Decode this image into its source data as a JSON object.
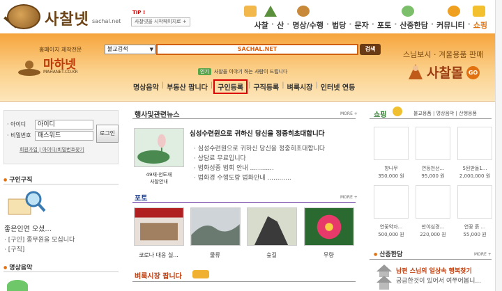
{
  "header": {
    "logo_text": "사찰넷",
    "logo_domain": "sachal.net",
    "tip_label": "TIP !",
    "tip_box": "사찰넷을 시작페이지로 +",
    "nav": [
      "사찰",
      "산",
      "명상/수행",
      "법당",
      "문자",
      "포토",
      "산중한담",
      "커뮤니티",
      "쇼핑"
    ]
  },
  "banner": {
    "mahanet_small": "홈페이지 제작전문",
    "mahanet_name": "마하넷",
    "mahanet_sub": "MAHANET.CO.KR",
    "search_select": "불교검색",
    "search_value": "SACHAL.NET",
    "search_button": "검색",
    "popular_tag": "인기",
    "popular_text": "사찰을 이야기 하는 사람이 드립니다",
    "links": [
      "명상음악",
      "부동산 팝니다",
      "구인등록",
      "구직등록",
      "벼룩시장",
      "인터넷 연등"
    ],
    "mall_top": "스님보시 · 겨울용품 판매",
    "mall_name": "사찰몰",
    "mall_go": "GO"
  },
  "login": {
    "id_label": "· 아이디",
    "pw_label": "· 비밀번호",
    "id_value": "아이디",
    "pw_value": "패스워드",
    "button": "로그인",
    "join": "회원가입",
    "find": "아이디/비밀번호찾기"
  },
  "left": {
    "job_title": "구인구직",
    "job_item1": "좋은인연 오셨...",
    "job_item2": "· [구인] 종무원을 모십니다",
    "job_item3": "· [구직]",
    "music_title": "명상음악"
  },
  "events": {
    "title": "행사및관련뉴스",
    "more": "MORE +",
    "headline": "심성수련원으로 귀하신 당신을 정중히초대합니다",
    "items": [
      "· 심성수련원으로 귀하신 당신을 정중히초대합니다",
      "· 상담료 무료입니다",
      "· 법화성종 법회 안내 ............",
      "· 법화경 수행도량 법화안내 ............"
    ],
    "thumb_caption1": "49재·천도재",
    "thumb_caption2": "사찰안내"
  },
  "photo": {
    "title": "포토",
    "more": "MORE +",
    "captions": [
      "코로나 대응 실...",
      "물류",
      "숲길",
      "무량"
    ]
  },
  "flea": {
    "title": "벼룩시장 팝니다"
  },
  "shop": {
    "title": "쇼핑",
    "links": "불교용품 | 명상음악 | 산행용품",
    "items": [
      {
        "name": "향나무",
        "price": "350,000 원"
      },
      {
        "name": "연등천선...",
        "price": "95,000 원"
      },
      {
        "name": "5된받돌1...",
        "price": "2,000,000 원"
      },
      {
        "name": "연꽃약자...",
        "price": "500,000 원"
      },
      {
        "name": "반야심경...",
        "price": "220,000 원"
      },
      {
        "name": "연꽃 흙 ...",
        "price": "55,000 원"
      }
    ]
  },
  "talk": {
    "title": "산중한담",
    "more": "MORE +",
    "line1": "남편 스님의 얼상속 행복찾기",
    "line2": "궁금한것이 있어서 여쭈어봅니..."
  },
  "colors": {
    "accent": "#e07010",
    "banner_top": "#f6a43c",
    "brand_brown": "#6b4316"
  }
}
